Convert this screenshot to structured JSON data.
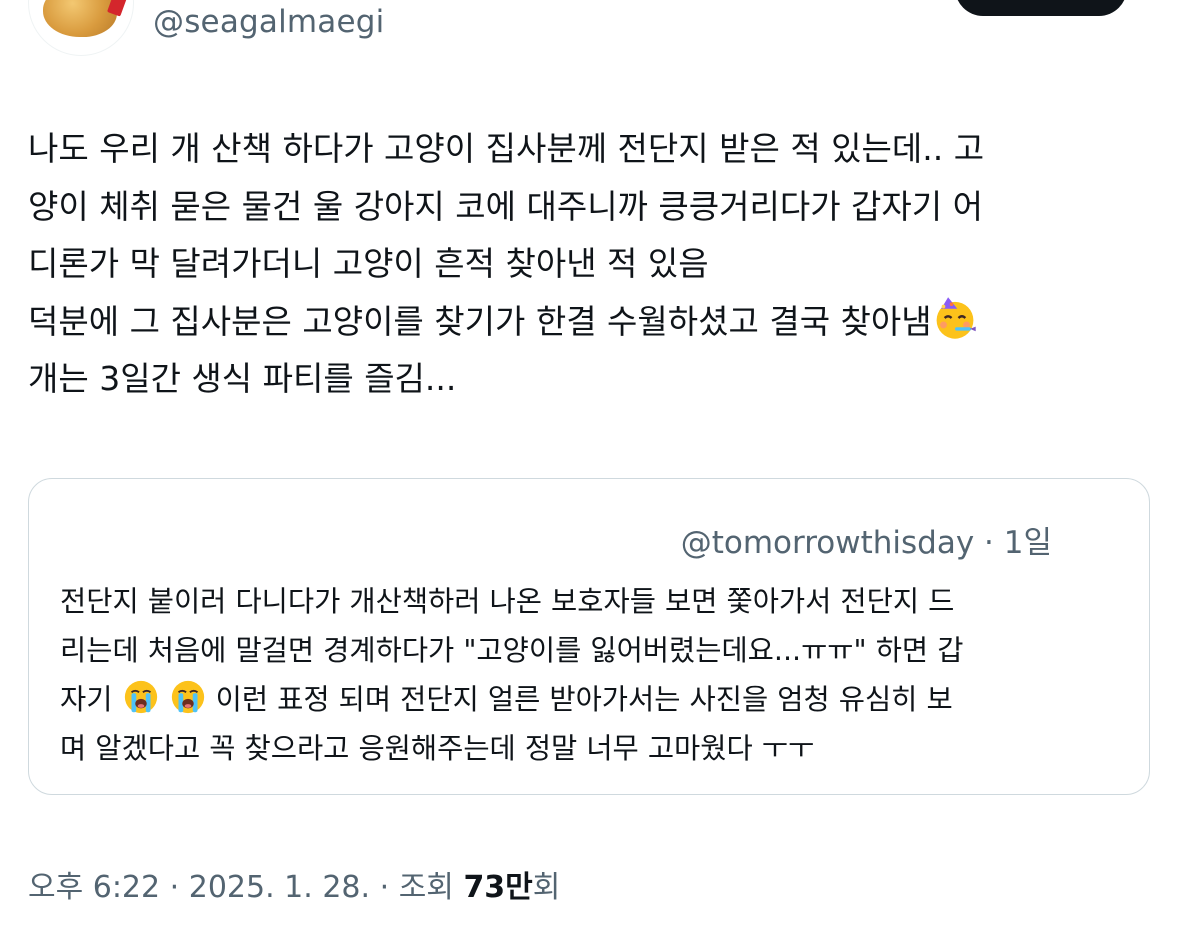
{
  "author": {
    "handle": "@seagalmaegi"
  },
  "tweet": {
    "lines": [
      "나도 우리 개 산책 하다가 고양이 집사분께 전단지 받은 적 있는데.. 고",
      "양이 체취 묻은 물건 울 강아지 코에 대주니까 킁킁거리다가 갑자기 어",
      "디론가 막 달려가더니 고양이 흔적 찾아낸 적 있음",
      "덕분에 그 집사분은 고양이를 찾기가 한결 수월하셨고 결국 찾아냄",
      "개는 3일간 생식 파티를 즐김..."
    ],
    "emoji": "partying-face-icon"
  },
  "quote": {
    "handle": "@tomorrowthisday",
    "time": "· 1일",
    "line1": "전단지 붙이러 다니다가 개산책하러 나온 보호자들 보면 쫓아가서 전단지 드",
    "line2": "리는데 처음에 말걸면 경계하다가 \"고양이를 잃어버렸는데요...ㅠㅠ\" 하면 갑",
    "line3_prefix": "자기",
    "line3_suffix": "이런 표정 되며 전단지 얼른 받아가서는 사진을 엄청 유심히 보",
    "line4": "며 알겠다고 꼭 찾으라고 응원해주는데 정말 너무 고마웠다 ㅜㅜ",
    "emoji": "loudly-crying-face-icon"
  },
  "meta": {
    "time": "오후 6:22",
    "date": "2025. 1. 28.",
    "views_label": "조회",
    "views_count": "73만",
    "views_suffix": "회"
  },
  "colors": {
    "text": "#0f1419",
    "secondary": "#536471",
    "border": "#cfd9de"
  }
}
